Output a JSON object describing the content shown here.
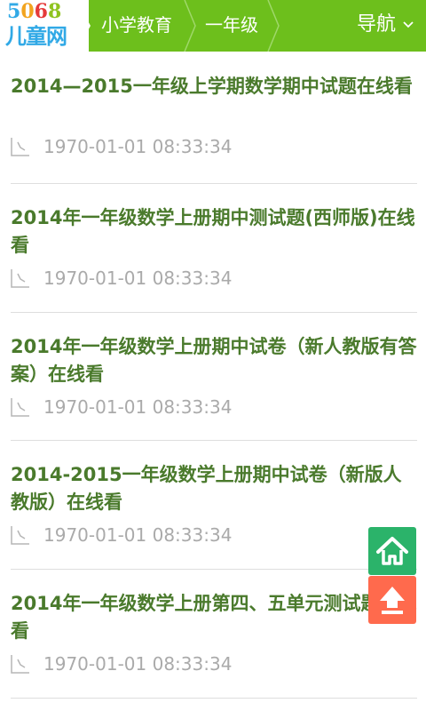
{
  "header": {
    "logo": {
      "digits": [
        "5",
        "0",
        "6",
        "8"
      ],
      "name": "儿童网"
    },
    "breadcrumbs": [
      "小学教育",
      "一年级"
    ],
    "nav_label": "导航",
    "colors": {
      "bar": "#6dbf1c",
      "logo_blue": "#31a9e6"
    }
  },
  "articles": [
    {
      "title": "2014—2015一年级上学期数学期中试题在线看",
      "time": "1970-01-01 08:33:34"
    },
    {
      "title": "2014年一年级数学上册期中测试题(西师版)在线看",
      "time": "1970-01-01 08:33:34"
    },
    {
      "title": "2014年一年级数学上册期中试卷（新人教版有答案）在线看",
      "time": "1970-01-01 08:33:34"
    },
    {
      "title": "2014-2015一年级数学上册期中试卷（新版人教版）在线看",
      "time": "1970-01-01 08:33:34"
    },
    {
      "title": "2014年一年级数学上册第四、五单元测试题在线看",
      "time": "1970-01-01 08:33:34"
    }
  ],
  "floating_buttons": [
    {
      "icon": "home-icon",
      "color": "#2bb36a"
    },
    {
      "icon": "arrow-up-icon",
      "color": "#ff6a4d"
    }
  ]
}
